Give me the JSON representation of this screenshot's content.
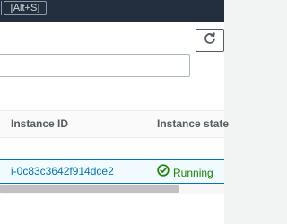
{
  "topbar": {
    "search_shortcut": "[Alt+S]"
  },
  "toolbar": {
    "refresh_icon": "refresh-icon"
  },
  "search": {
    "value": "",
    "placeholder": ""
  },
  "table": {
    "columns": [
      "Instance ID",
      "Instance state"
    ],
    "rows": [
      {
        "instance_id": "i-0c83c3642f914dce2",
        "state": "Running",
        "state_icon": "check-circle-icon"
      }
    ]
  },
  "colors": {
    "topbar": "#232f3e",
    "link": "#0073bb",
    "running": "#1d8102",
    "selected_row": "#f1faff"
  }
}
